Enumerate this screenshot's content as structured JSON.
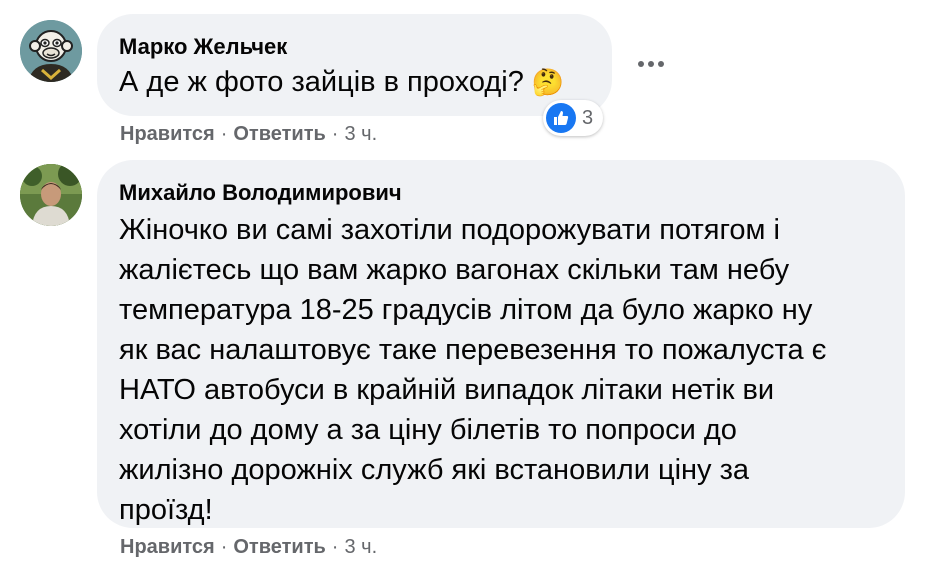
{
  "comments": [
    {
      "author": "Марко Жельчек",
      "text": "А де ж фото зайців в проході?",
      "emoji": "🤔",
      "like_label": "Нравится",
      "reply_label": "Ответить",
      "time": "3 ч.",
      "reaction_count": "3",
      "reaction_icon": "thumbs-up-icon"
    },
    {
      "author": "Михайло Володимирович",
      "text_lines": [
        "Жіночко ви самі захотіли подорожувати потягом і",
        "жалієтесь що вам жарко вагонах скільки там небу",
        "температура 18-25 градусів літом да було жарко ну",
        "як вас налаштовує таке перевезення то пожалуста є",
        "НАТО автобуси в крайній випадок літаки нетік ви",
        "хотіли до дому а за ціну білетів то попроси до",
        "жилізно дорожніх служб які встановили ціну за",
        "проїзд!"
      ],
      "like_label": "Нравится",
      "reply_label": "Ответить",
      "time": "3 ч."
    }
  ],
  "colors": {
    "bubble": "#f0f2f5",
    "meta": "#65676b",
    "like_blue": "#1877f2"
  }
}
